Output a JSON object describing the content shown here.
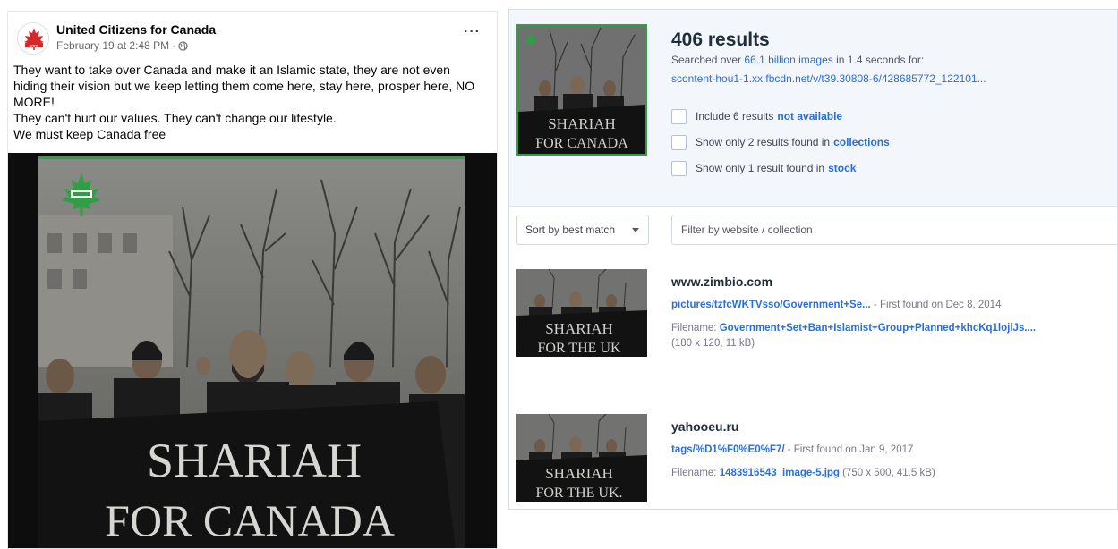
{
  "facebook_post": {
    "page_name": "United Citizens for Canada",
    "timestamp": "February 19 at 2:48 PM",
    "separator": "·",
    "more_label": "···",
    "text_lines": [
      "They want to take over Canada and make it an Islamic state, they are not even",
      "hiding their vision but we keep letting them come here, stay here, prosper here, NO",
      "MORE!",
      "They can't hurt our values. They can't change our lifestyle.",
      "We must keep Canada free"
    ],
    "image": {
      "banner_line1": "SHARIAH",
      "banner_line2": "FOR CANADA",
      "logo_icon": "maple-leaf-icon",
      "border_color": "#2f9e44"
    },
    "avatar_icon": "maple-leaf-avatar-icon",
    "avatar_color": "#d62828"
  },
  "tineye": {
    "results_count": "406 results",
    "searched_prefix": "Searched over ",
    "searched_highlight": "66.1 billion images",
    "searched_suffix": " in 1.4 seconds for:",
    "query_url": "scontent-hou1-1.xx.fbcdn.net/v/t39.30808-6/428685772_122101...",
    "checkboxes": [
      {
        "prefix": "Include 6 results",
        "link": "not available"
      },
      {
        "prefix": "Show only 2 results found in",
        "link": "collections"
      },
      {
        "prefix": "Show only 1 result found in",
        "link": "stock"
      }
    ],
    "sort_label": "Sort by best match",
    "filter_placeholder": "Filter by website / collection",
    "results": [
      {
        "site": "www.zimbio.com",
        "page_link": "pictures/tzfcWKTVsso/Government+Se...",
        "found": " - First found on Dec 8, 2014",
        "filename_label": "Filename: ",
        "filename": "Government+Set+Ban+Islamist+Group+Planned+khcKq1lojlJs....",
        "dims": "(180 x 120, 11 kB)",
        "banner_line1": "SHARIAH",
        "banner_line2": "FOR THE UK"
      },
      {
        "site": "yahooeu.ru",
        "page_link": "tags/%D1%F0%E0%F7/",
        "found": " - First found on Jan 9, 2017",
        "filename_label": "Filename: ",
        "filename": "1483916543_image-5.jpg",
        "dims": " (750 x 500, 41.5 kB)",
        "banner_line1": "SHARIAH",
        "banner_line2": "FOR THE UK."
      }
    ],
    "query_banner_line1": "SHARIAH",
    "query_banner_line2": "FOR CANADA",
    "accent_color": "#2a6fd6"
  }
}
